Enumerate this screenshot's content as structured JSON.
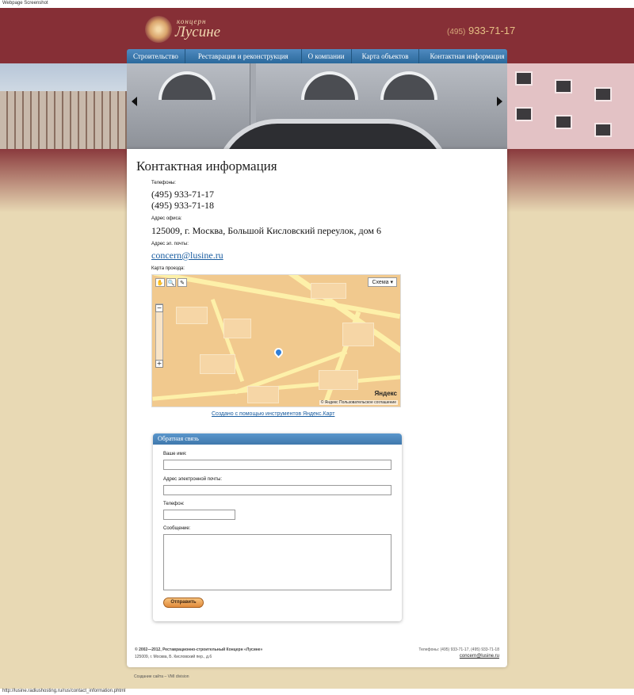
{
  "window": {
    "title": "Webpage Screenshot",
    "status_url": "http://lusine.radiushosting.ru/rus/contact_information.phtml"
  },
  "header": {
    "logo_small": "концерн",
    "logo_big": "Лусине",
    "phone_code": "(495)",
    "phone_number": "933-71-17"
  },
  "nav": [
    {
      "label": "Строительство"
    },
    {
      "label": "Реставрация и реконструкция"
    },
    {
      "label": "О компании"
    },
    {
      "label": "Карта объектов"
    },
    {
      "label": "Контактная информация"
    }
  ],
  "contacts": {
    "title": "Контактная информация",
    "phones_label": "Телефоны:",
    "phone1": "(495) 933-71-17",
    "phone2": "(495) 933-71-18",
    "address_label": "Адрес офиса:",
    "address": "125009, г. Москва, Большой Кисловский переулок, дом 6",
    "email_label": "Адрес эл. почты:",
    "email": "concern@lusine.ru",
    "map_label": "Карта проезда:"
  },
  "map": {
    "scheme": "Схема ▾",
    "brand": "Яндекс",
    "terms": "© Яндекс Пользовательское соглашение",
    "caption": "Создано с помощью инструментов Яндекс.Карт",
    "zoom_in": "+",
    "zoom_out": "−",
    "tool_hand": "✋",
    "tool_zoom": "🔍",
    "tool_ruler": "✎"
  },
  "form": {
    "title": "Обратная связь",
    "name_label": "Ваше имя:",
    "email_label": "Адрес электронной почты:",
    "phone_label": "Телефон:",
    "message_label": "Сообщение:",
    "submit": "Отправить"
  },
  "footer": {
    "copyright": "© 2002—2012, Реставрационно-строительный Концерн «Лусине»",
    "address": "125009, г. Москва, Б. Кисловский пер., д.6",
    "phones": "Телефоны: (495) 933-71-17, (495) 933-71-18",
    "email": "concern@lusine.ru",
    "creator": "Создание сайта – VMI division"
  }
}
